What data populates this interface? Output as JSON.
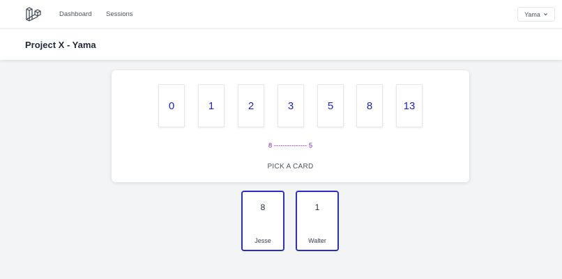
{
  "nav": {
    "logo_icon": "laravel-logo-icon",
    "links": [
      "Dashboard",
      "Sessions"
    ],
    "user": "Yama",
    "user_caret_icon": "chevron-down-icon"
  },
  "header": {
    "title": "Project X - Yama"
  },
  "deck": {
    "cards": [
      "0",
      "1",
      "2",
      "3",
      "5",
      "8",
      "13"
    ],
    "range": "8 --------------- 5",
    "prompt": "PICK A CARD"
  },
  "votes": [
    {
      "value": "8",
      "name": "Jesse"
    },
    {
      "value": "1",
      "name": "Walter"
    }
  ],
  "colors": {
    "accent": "#1e22c8",
    "range": "#7e22ce",
    "vote_border": "#2c2cc6"
  }
}
